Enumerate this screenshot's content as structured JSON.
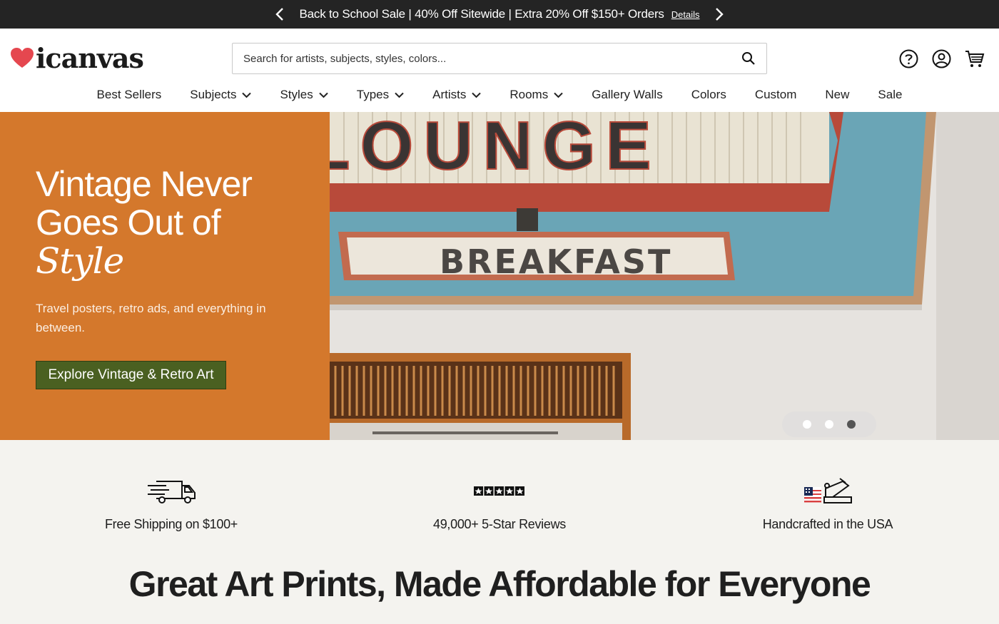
{
  "promo": {
    "message": "Back to School Sale | 40% Off Sitewide | Extra 20% Off $150+ Orders",
    "details_label": "Details"
  },
  "header": {
    "logo_text": "icanvas",
    "search_placeholder": "Search for artists, subjects, styles, colors...",
    "icons": [
      "help-icon",
      "account-icon",
      "cart-icon"
    ]
  },
  "nav": {
    "items": [
      {
        "label": "Best Sellers",
        "dropdown": false
      },
      {
        "label": "Subjects",
        "dropdown": true
      },
      {
        "label": "Styles",
        "dropdown": true
      },
      {
        "label": "Types",
        "dropdown": true
      },
      {
        "label": "Artists",
        "dropdown": true
      },
      {
        "label": "Rooms",
        "dropdown": true
      },
      {
        "label": "Gallery Walls",
        "dropdown": false
      },
      {
        "label": "Colors",
        "dropdown": false
      },
      {
        "label": "Custom",
        "dropdown": false
      },
      {
        "label": "New",
        "dropdown": false
      },
      {
        "label": "Sale",
        "dropdown": false
      }
    ]
  },
  "hero": {
    "title_line1": "Vintage Never",
    "title_line2": "Goes Out of",
    "title_line3": "Style",
    "subtitle": "Travel posters, retro ads, and everything in between.",
    "cta_label": "Explore Vintage & Retro Art",
    "image_sign_top": "LOUNGE",
    "image_sign_bottom": "BREAKFAST",
    "carousel": {
      "count": 3,
      "active": 1
    },
    "colors": {
      "panel": "#d4782c",
      "cta": "#4a6021"
    }
  },
  "features": [
    {
      "icon": "delivery-truck-icon",
      "label": "Free Shipping on $100+"
    },
    {
      "icon": "five-stars-icon",
      "label": "49,000+ 5-Star Reviews"
    },
    {
      "icon": "usa-flag-stapler-icon",
      "label": "Handcrafted in the USA"
    }
  ],
  "headline": "Great Art Prints, Made Affordable for Everyone"
}
